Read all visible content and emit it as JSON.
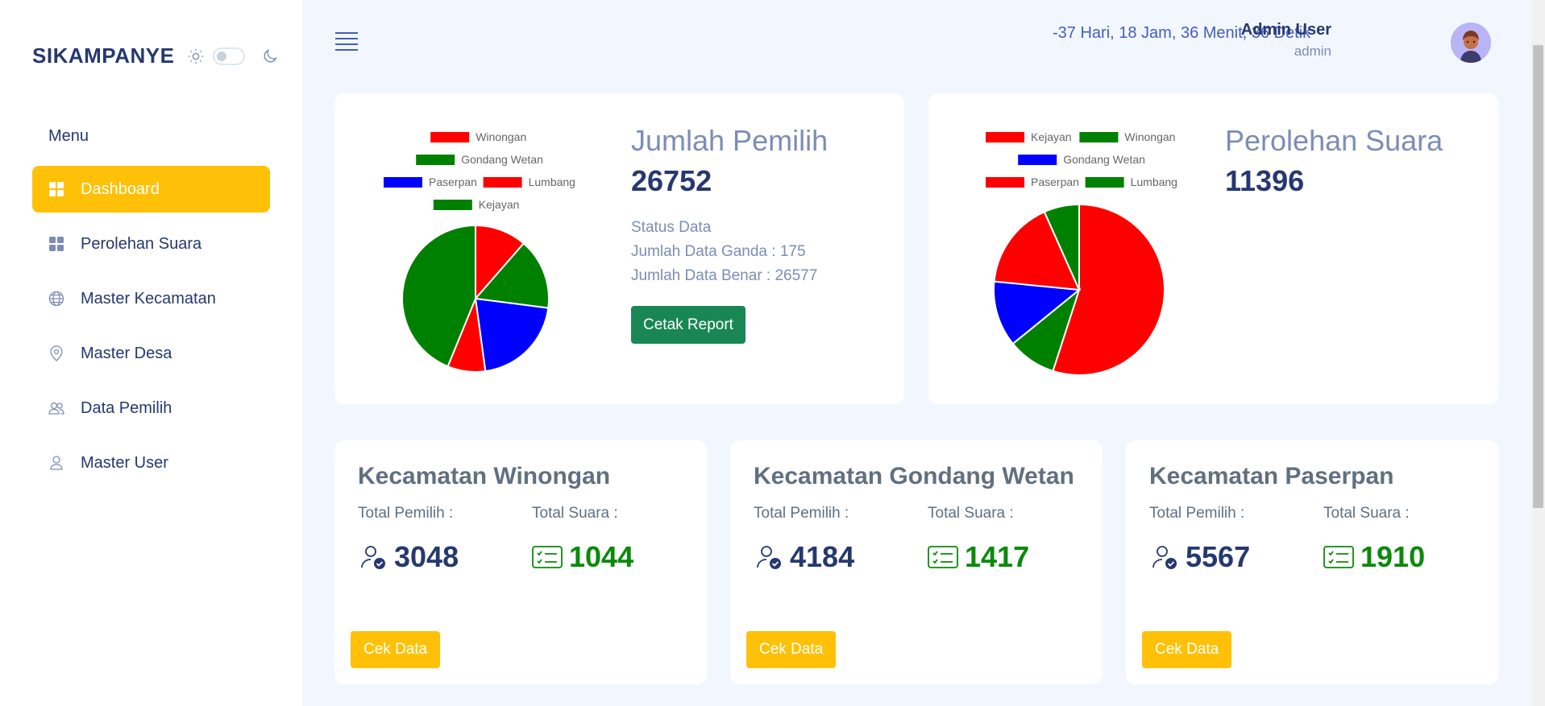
{
  "sidebar": {
    "brand": "SIKAMPANYE",
    "menu_title": "Menu",
    "items": [
      {
        "label": "Dashboard",
        "icon": "grid-icon",
        "active": true
      },
      {
        "label": "Perolehan Suara",
        "icon": "grid-icon"
      },
      {
        "label": "Master Kecamatan",
        "icon": "globe-icon"
      },
      {
        "label": "Master Desa",
        "icon": "map-pin-icon"
      },
      {
        "label": "Data Pemilih",
        "icon": "users-icon"
      },
      {
        "label": "Master User",
        "icon": "user-icon"
      }
    ]
  },
  "header": {
    "countdown": "-37 Hari, 18 Jam, 36 Menit, 36 Detik",
    "user_name": "Admin User",
    "user_role": "admin"
  },
  "card1": {
    "title": "Jumlah Pemilih",
    "value": "26752",
    "status_title": "Status Data",
    "ganda": "Jumlah Data Ganda : 175",
    "benar": "Jumlah Data Benar : 26577",
    "button": "Cetak Report"
  },
  "card2": {
    "title": "Perolehan Suara",
    "value": "11396"
  },
  "kecamatan": [
    {
      "title": "Kecamatan Winongan",
      "pemilih_label": "Total Pemilih :",
      "suara_label": "Total Suara :",
      "pemilih": "3048",
      "suara": "1044",
      "button": "Cek Data"
    },
    {
      "title": "Kecamatan Gondang Wetan",
      "pemilih_label": "Total Pemilih :",
      "suara_label": "Total Suara :",
      "pemilih": "4184",
      "suara": "1417",
      "button": "Cek Data"
    },
    {
      "title": "Kecamatan Paserpan",
      "pemilih_label": "Total Pemilih :",
      "suara_label": "Total Suara :",
      "pemilih": "5567",
      "suara": "1910",
      "button": "Cek Data"
    }
  ],
  "colors": {
    "accent": "#ffc107",
    "primary": "#25396f",
    "green": "#198754"
  },
  "chart_data": [
    {
      "type": "pie",
      "title": "",
      "legend_position": "top",
      "categories": [
        "Winongan",
        "Gondang Wetan",
        "Paserpan",
        "Lumbang",
        "Kejayan"
      ],
      "colors": [
        "#ff0000",
        "#008000",
        "#0000ff",
        "#ff0000",
        "#008000"
      ],
      "values": [
        3048,
        4184,
        5567,
        2230,
        11723
      ]
    },
    {
      "type": "pie",
      "title": "",
      "legend_position": "top",
      "categories": [
        "Kejayan",
        "Winongan",
        "Gondang Wetan",
        "Paserpan",
        "Lumbang"
      ],
      "colors": [
        "#ff0000",
        "#008000",
        "#0000ff",
        "#ff0000",
        "#008000"
      ],
      "values": [
        6264,
        1044,
        1417,
        1910,
        761
      ]
    }
  ]
}
